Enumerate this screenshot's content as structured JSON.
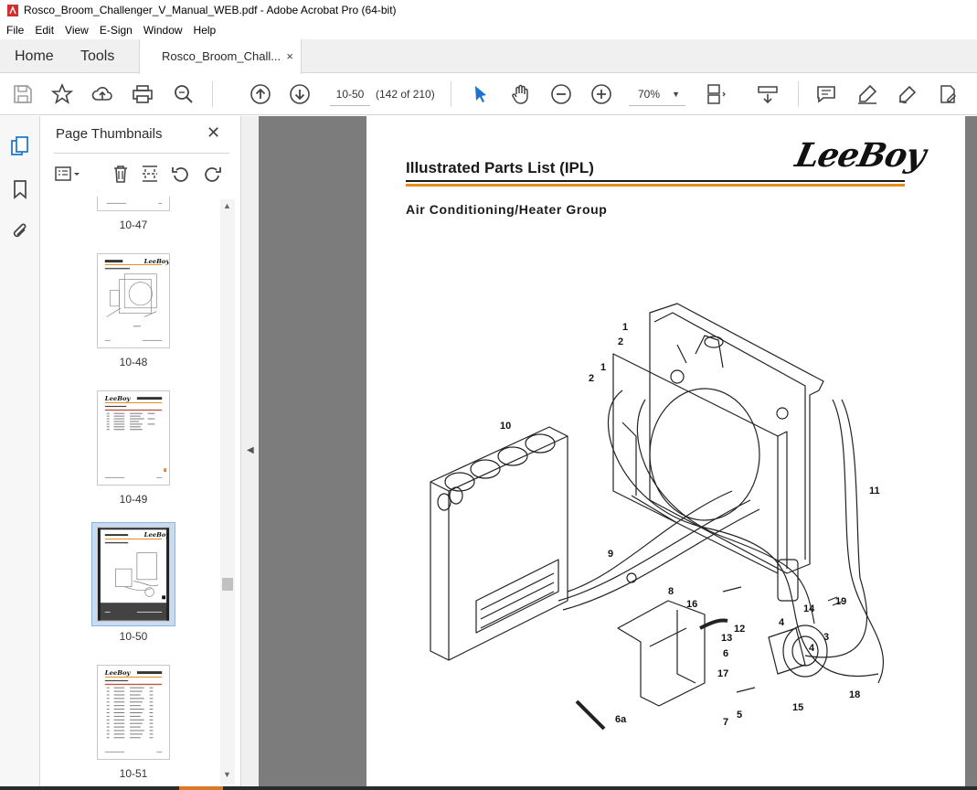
{
  "window": {
    "title": "Rosco_Broom_Challenger_V_Manual_WEB.pdf - Adobe Acrobat Pro (64-bit)"
  },
  "menu": [
    "File",
    "Edit",
    "View",
    "E-Sign",
    "Window",
    "Help"
  ],
  "tabs": {
    "home": "Home",
    "tools": "Tools",
    "document": "Rosco_Broom_Chall...",
    "close": "×"
  },
  "toolbar": {
    "page_input": "10-50",
    "page_count": "(142 of 210)",
    "zoom": "70%",
    "zoom_caret": "▼"
  },
  "sidebar": {
    "title": "Page Thumbnails",
    "close": "✕",
    "thumbnails": [
      {
        "label": "10-47"
      },
      {
        "label": "10-48"
      },
      {
        "label": "10-49"
      },
      {
        "label": "10-50",
        "selected": true
      },
      {
        "label": "10-51"
      }
    ]
  },
  "page": {
    "title": "Illustrated Parts List (IPL)",
    "subtitle": "Air Conditioning/Heater Group",
    "logo": "LeeBoy",
    "callouts": [
      "1",
      "2",
      "1",
      "2",
      "10",
      "9",
      "8",
      "16",
      "11",
      "19",
      "14",
      "12",
      "13",
      "4",
      "4",
      "3",
      "6",
      "17",
      "15",
      "18",
      "5",
      "7",
      "6a"
    ]
  },
  "colors": {
    "accent_orange": "#e58c1f",
    "viewer_bg": "#7c7c7c",
    "selected_thumb": "#c7dcf2",
    "acrobat_red": "#d32f2f"
  }
}
